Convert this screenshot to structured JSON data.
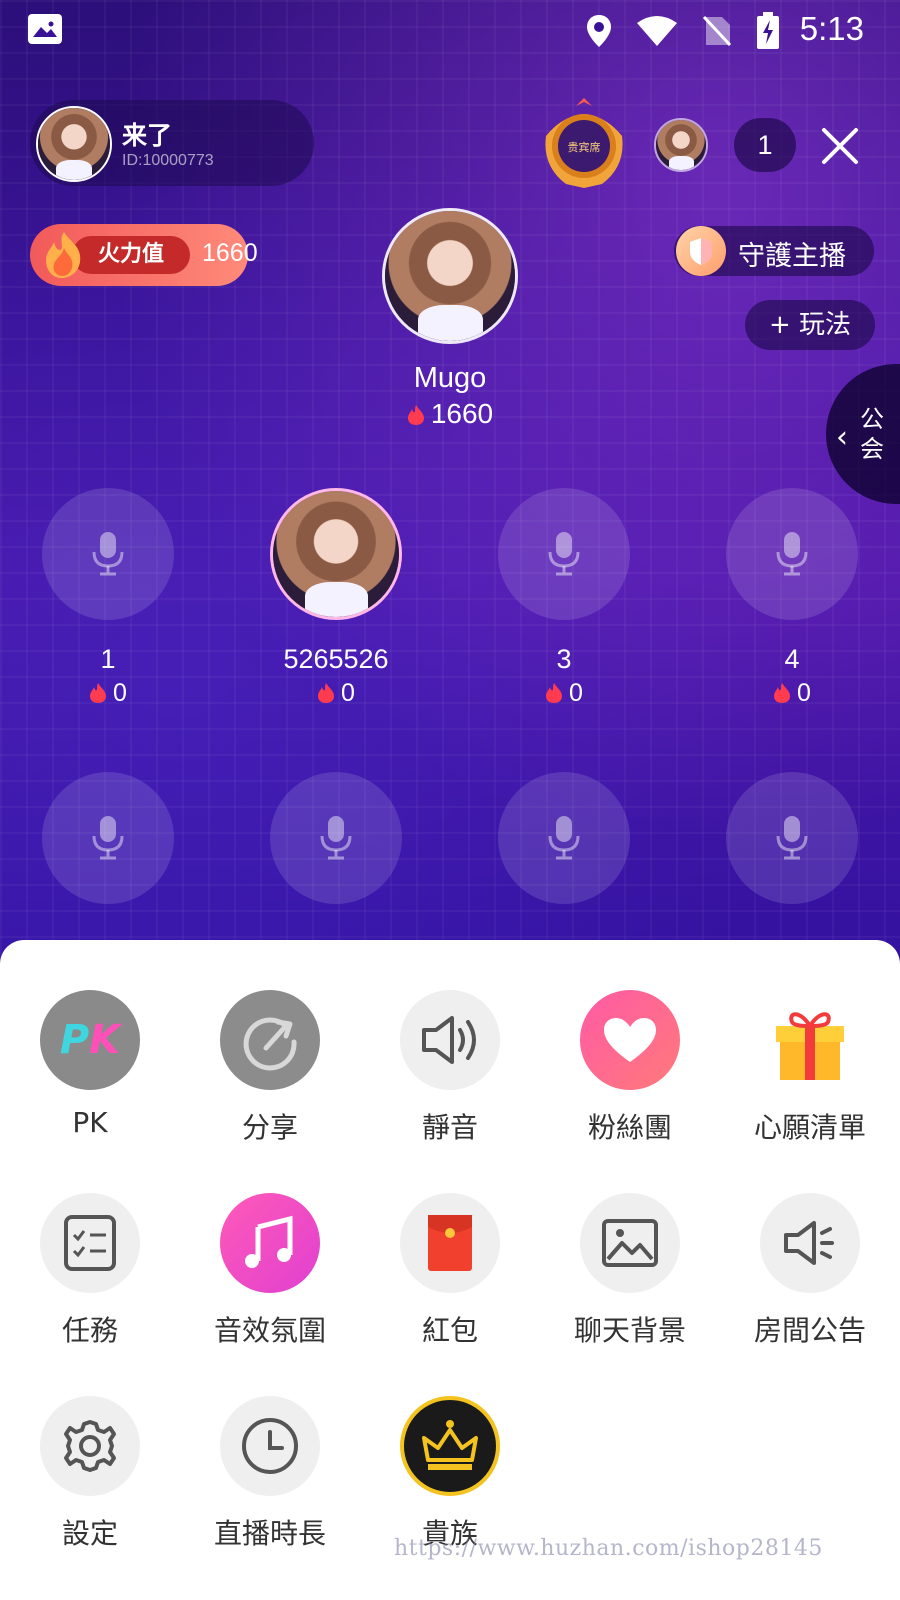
{
  "status_bar": {
    "time": "5:13"
  },
  "host": {
    "name": "来了",
    "id": "ID:10000773"
  },
  "vip_badge": {
    "label": "贵宾席"
  },
  "viewer_count": "1",
  "fire": {
    "label": "火力值",
    "value": "1660"
  },
  "guard": {
    "label": "守護主播"
  },
  "play": {
    "label": "+ 玩法"
  },
  "main_host": {
    "name": "Mugo",
    "score": "1660"
  },
  "guild": {
    "label": "公会"
  },
  "seats": [
    {
      "name": "1",
      "score": "0"
    },
    {
      "name": "5265526",
      "score": "0"
    },
    {
      "name": "3",
      "score": "0"
    },
    {
      "name": "4",
      "score": "0"
    }
  ],
  "tools": [
    {
      "label": "PK",
      "icon": "pk-icon"
    },
    {
      "label": "分享",
      "icon": "share-icon"
    },
    {
      "label": "靜音",
      "icon": "speaker-icon"
    },
    {
      "label": "粉絲團",
      "icon": "heart-icon"
    },
    {
      "label": "心願清單",
      "icon": "gift-icon"
    },
    {
      "label": "任務",
      "icon": "checklist-icon"
    },
    {
      "label": "音效氛圍",
      "icon": "music-icon"
    },
    {
      "label": "紅包",
      "icon": "red-envelope-icon"
    },
    {
      "label": "聊天背景",
      "icon": "image-icon"
    },
    {
      "label": "房間公告",
      "icon": "announcement-icon"
    },
    {
      "label": "設定",
      "icon": "gear-icon"
    },
    {
      "label": "直播時長",
      "icon": "clock-icon"
    },
    {
      "label": "貴族",
      "icon": "crown-icon"
    }
  ],
  "watermark": "https://www.huzhan.com/ishop28145",
  "colors": {
    "accent_pink": "#ff4f8b",
    "sheet_bg": "#ffffff",
    "room_bg": "#3a1296"
  }
}
